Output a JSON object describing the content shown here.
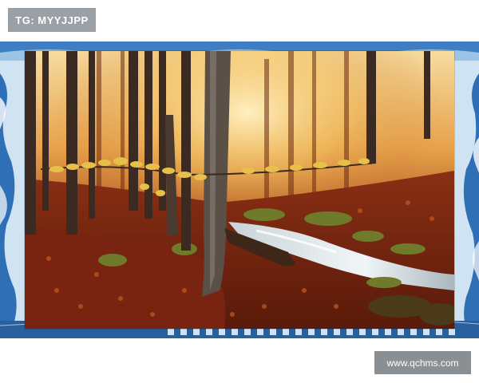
{
  "tag": {
    "text": "TG: MYYJJPP"
  },
  "watermark": {
    "text": "www.qchms.com"
  },
  "colors": {
    "band_blue": "#2f6fb5",
    "band_light": "#cfe3f3",
    "badge_gray": "#9aa0a6",
    "watermark_gray": "#8a8f94",
    "leaf_red": "#8a2a14",
    "leaf_orange": "#d9842b",
    "mist_yellow": "#f4d27a",
    "stream_white": "#e8eef2"
  }
}
